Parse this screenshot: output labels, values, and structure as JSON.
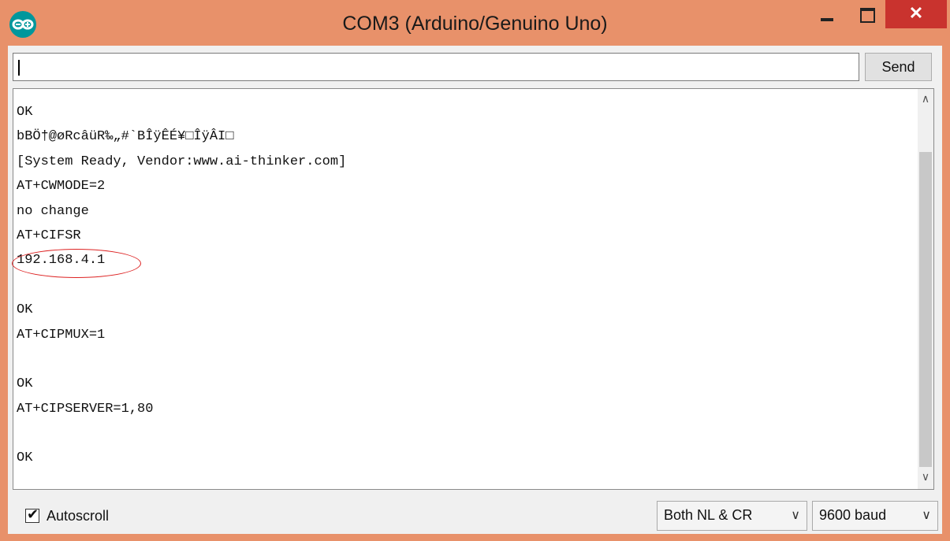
{
  "window": {
    "title": "COM3 (Arduino/Genuino Uno)",
    "close_glyph": "✕"
  },
  "input": {
    "value": "",
    "send_label": "Send"
  },
  "output": {
    "lines": [
      "OK",
      "bBÖ†@øRcâüR‰„#`BÎÿÊÉ¥□ÎÿÂI□",
      "[System Ready, Vendor:www.ai-thinker.com]",
      "AT+CWMODE=2",
      "no change",
      "AT+CIFSR",
      "192.168.4.1",
      "",
      "OK",
      "AT+CIPMUX=1",
      "",
      "OK",
      "AT+CIPSERVER=1,80",
      "",
      "OK"
    ]
  },
  "footer": {
    "autoscroll_label": "Autoscroll",
    "autoscroll_checked": true,
    "line_ending": "Both NL & CR",
    "baud": "9600 baud"
  },
  "colors": {
    "titlebar": "#e8916a",
    "close": "#c9332e",
    "arduino": "#00979c",
    "annotation": "#dd2222"
  }
}
